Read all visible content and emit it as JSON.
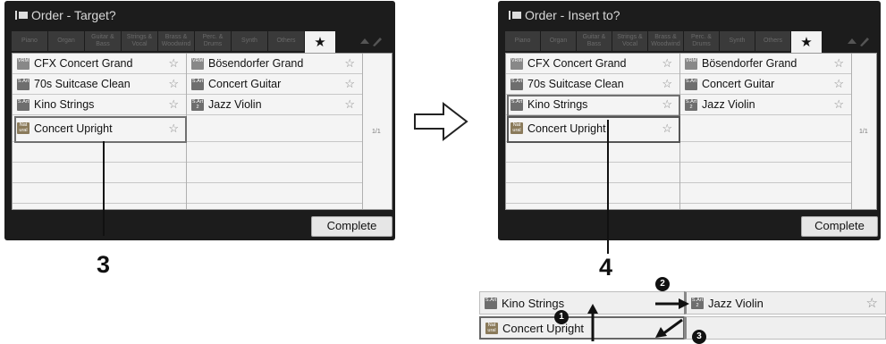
{
  "left_screen": {
    "title": "Order - Target?",
    "tabs": [
      "Piano",
      "Organ",
      "Guitar & Bass",
      "Strings & Vocal",
      "Brass & Woodwind",
      "Perc. & Drums",
      "Synth",
      "Others"
    ],
    "active_tab": "★",
    "items_left": [
      {
        "badge": "VRM",
        "name": "CFX Concert Grand"
      },
      {
        "badge": "S.Art",
        "name": "70s Suitcase Clean"
      },
      {
        "badge": "S.Art",
        "name": "Kino Strings"
      },
      {
        "badge": "Nat ural",
        "name": "Concert Upright"
      }
    ],
    "items_right": [
      {
        "badge": "VRM",
        "name": "Bösendorfer Grand"
      },
      {
        "badge": "S.Art",
        "name": "Concert Guitar"
      },
      {
        "badge": "S.Art 2",
        "name": "Jazz Violin"
      }
    ],
    "page": "1/1",
    "complete_label": "Complete",
    "callout": "3"
  },
  "right_screen": {
    "title": "Order - Insert to?",
    "tabs": [
      "Piano",
      "Organ",
      "Guitar & Bass",
      "Strings & Vocal",
      "Brass & Woodwind",
      "Perc. & Drums",
      "Synth",
      "Others"
    ],
    "active_tab": "★",
    "items_left": [
      {
        "badge": "VRM",
        "name": "CFX Concert Grand"
      },
      {
        "badge": "S.Art",
        "name": "70s Suitcase Clean"
      },
      {
        "badge": "S.Art",
        "name": "Kino Strings"
      },
      {
        "badge": "Nat ural",
        "name": "Concert Upright"
      }
    ],
    "items_right": [
      {
        "badge": "VRM",
        "name": "Bösendorfer Grand"
      },
      {
        "badge": "S.Art",
        "name": "Concert Guitar"
      },
      {
        "badge": "S.Art 2",
        "name": "Jazz Violin"
      }
    ],
    "page": "1/1",
    "complete_label": "Complete",
    "callout": "4"
  },
  "star_glyph": "☆",
  "zoom": {
    "row1_left": {
      "badge": "S.Art",
      "name": "Kino Strings"
    },
    "row1_right": {
      "badge": "S.Art 2",
      "name": "Jazz Violin"
    },
    "row2_left": {
      "badge": "Nat ural",
      "name": "Concert Upright"
    },
    "steps": [
      "1",
      "2",
      "3"
    ]
  }
}
